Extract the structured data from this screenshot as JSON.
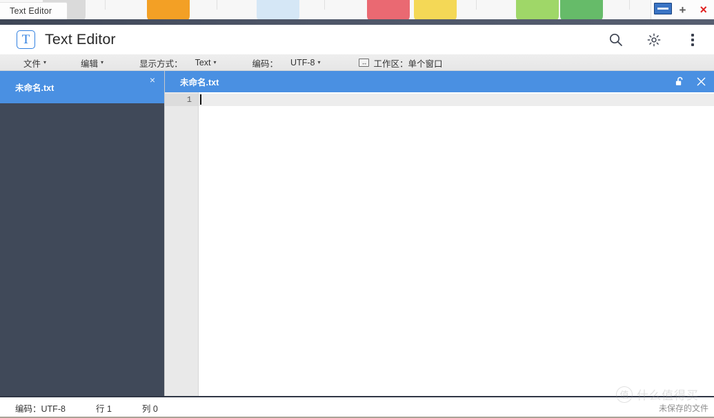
{
  "desktop": {
    "background_icons": [
      {
        "name": "gear-app-icon",
        "color": "#d5d5d5"
      },
      {
        "name": "folder-app-icon",
        "color": "#f29100"
      },
      {
        "name": "cloud-app-icon",
        "color": "#2f7fd0"
      },
      {
        "name": "grid-app-icon",
        "color": "#e8505b"
      },
      {
        "name": "note-app-icon",
        "color": "#f3d23a"
      },
      {
        "name": "music-app-icon",
        "color": "#7cc242"
      },
      {
        "name": "leaf-app-icon",
        "color": "#4cb050"
      }
    ]
  },
  "os_window": {
    "title": "Text Editor",
    "minimize_label": "—",
    "maximize_label": "+",
    "close_label": "×"
  },
  "app_header": {
    "logo_glyph": "T",
    "title": "Text Editor",
    "accent_color": "#4a90e2",
    "actions": [
      {
        "name": "search-icon",
        "label": "search"
      },
      {
        "name": "gear-icon",
        "label": "settings"
      },
      {
        "name": "more-vertical-icon",
        "label": "more"
      }
    ]
  },
  "menubar": {
    "file_label": "文件",
    "edit_label": "编辑",
    "view_mode_label": "显示方式：",
    "view_mode_value": "Text",
    "encoding_label": "编码：",
    "encoding_value": "UTF-8",
    "workspace_label": "工作区：",
    "workspace_value": "单个窗口",
    "caret_glyph": "▾",
    "workspace_icon_glyph": "↔"
  },
  "sidebar": {
    "background_color": "#404959",
    "tabs": [
      {
        "label": "未命名.txt",
        "active": true,
        "close_glyph": "×"
      }
    ]
  },
  "editor": {
    "tab": {
      "label": "未命名.txt",
      "lock_state": "unlocked",
      "close_glyph": "×"
    },
    "gutter": {
      "lines": [
        "1"
      ]
    },
    "content": [
      ""
    ],
    "cursor_line": 1,
    "cursor_column": 0
  },
  "statusbar": {
    "encoding_label": "编码：",
    "encoding_value": "UTF-8",
    "row_label": "行",
    "row_value": "1",
    "col_label": "列",
    "col_value": "0",
    "unsaved_text": "未保存的文件"
  },
  "watermark": {
    "mark_glyph": "值",
    "text": "什么值得买"
  }
}
